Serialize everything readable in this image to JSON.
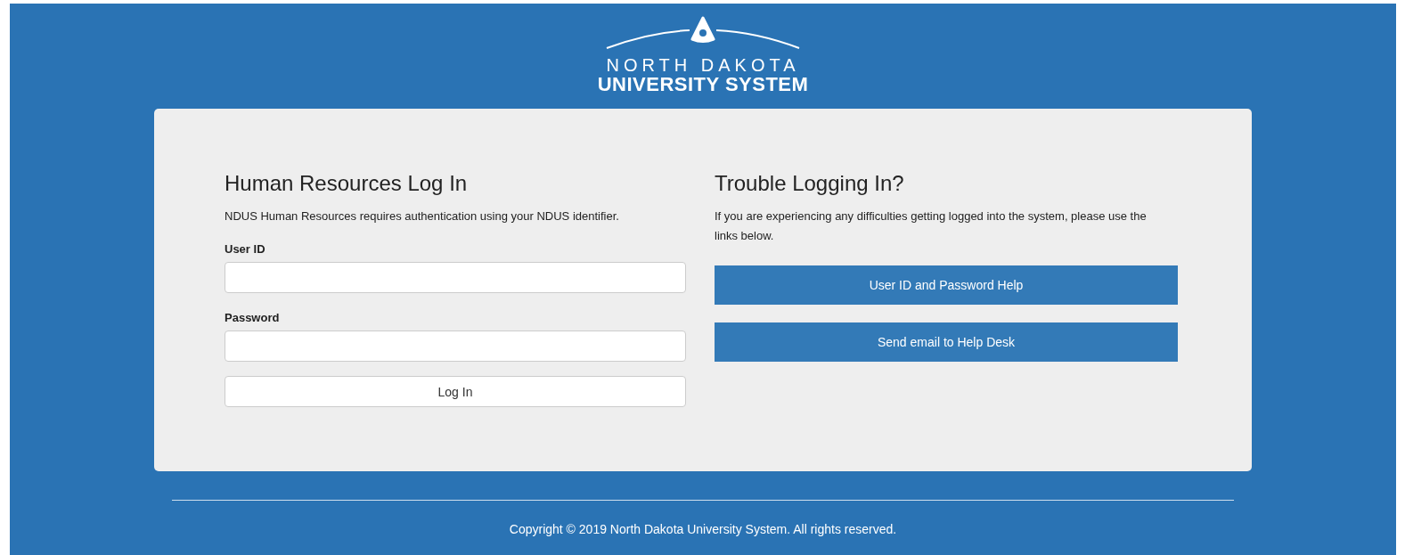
{
  "logo": {
    "line_1": "NORTH DAKOTA",
    "line_2": "UNIVERSITY SYSTEM"
  },
  "login": {
    "title": "Human Resources Log In",
    "intro": "NDUS Human Resources requires authentication using your NDUS identifier.",
    "fields": [
      {
        "label": "User ID"
      },
      {
        "label": "Password"
      }
    ],
    "button": "Log In"
  },
  "help": {
    "title": "Trouble Logging In?",
    "intro": "If you are experiencing any difficulties getting logged into the system, please use the links below.",
    "links": [
      "User ID and Password Help",
      "Send email to Help Desk"
    ]
  },
  "footer": {
    "copyright": "Copyright © 2019 North Dakota University System. All rights reserved."
  }
}
